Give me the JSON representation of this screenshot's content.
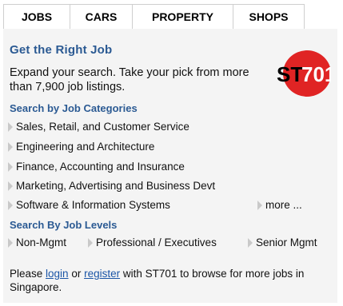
{
  "tabs": [
    {
      "label": "JOBS",
      "active": true
    },
    {
      "label": "CARS",
      "active": false
    },
    {
      "label": "PROPERTY",
      "active": false
    },
    {
      "label": "SHOPS",
      "active": false
    }
  ],
  "promo": {
    "title": "Get the Right Job",
    "text": "Expand your search. Take your pick from more than 7,900 job listings.",
    "logo_text_a": "ST",
    "logo_text_b": "701"
  },
  "categories": {
    "heading": "Search by Job Categories",
    "items": [
      "Sales, Retail, and Customer Service",
      "Engineering and Architecture",
      "Finance, Accounting and Insurance",
      "Marketing, Advertising and Business Devt",
      "Software & Information Systems"
    ],
    "more_label": "more ..."
  },
  "levels": {
    "heading": "Search By Job Levels",
    "items": [
      "Non-Mgmt",
      "Professional / Executives",
      "Senior Mgmt"
    ]
  },
  "footer": {
    "prefix": "Please ",
    "login_label": "login",
    "middle": " or ",
    "register_label": "register",
    "suffix": " with ST701 to browse for more jobs in Singapore."
  },
  "colors": {
    "heading_blue": "#2b5a93",
    "link_blue": "#1a55a6",
    "logo_red": "#e02424",
    "panel_bg": "#f4f4f4"
  }
}
